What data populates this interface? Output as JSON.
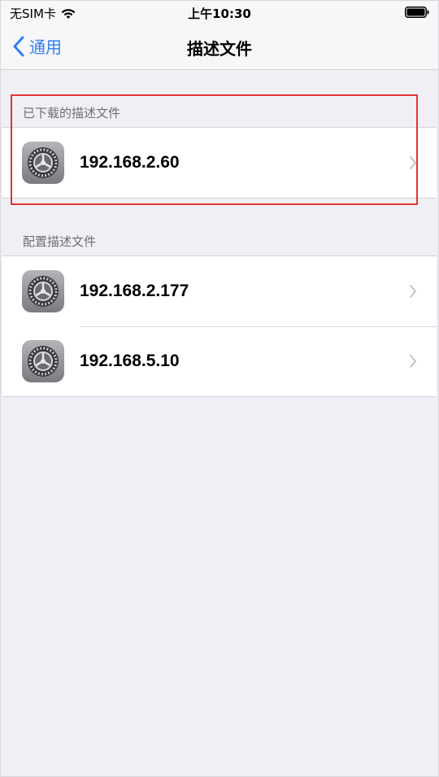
{
  "status_bar": {
    "carrier": "无SIM卡",
    "time": "上午10:30"
  },
  "nav": {
    "back_label": "通用",
    "title": "描述文件"
  },
  "sections": [
    {
      "header": "已下载的描述文件",
      "items": [
        {
          "label": "192.168.2.60",
          "icon": "settings-gear-icon"
        }
      ]
    },
    {
      "header": "配置描述文件",
      "items": [
        {
          "label": "192.168.2.177",
          "icon": "settings-gear-icon"
        },
        {
          "label": "192.168.5.10",
          "icon": "settings-gear-icon"
        }
      ]
    }
  ],
  "colors": {
    "accent": "#2f7cf6",
    "background": "#f0eff5",
    "highlight": "#e23434"
  }
}
